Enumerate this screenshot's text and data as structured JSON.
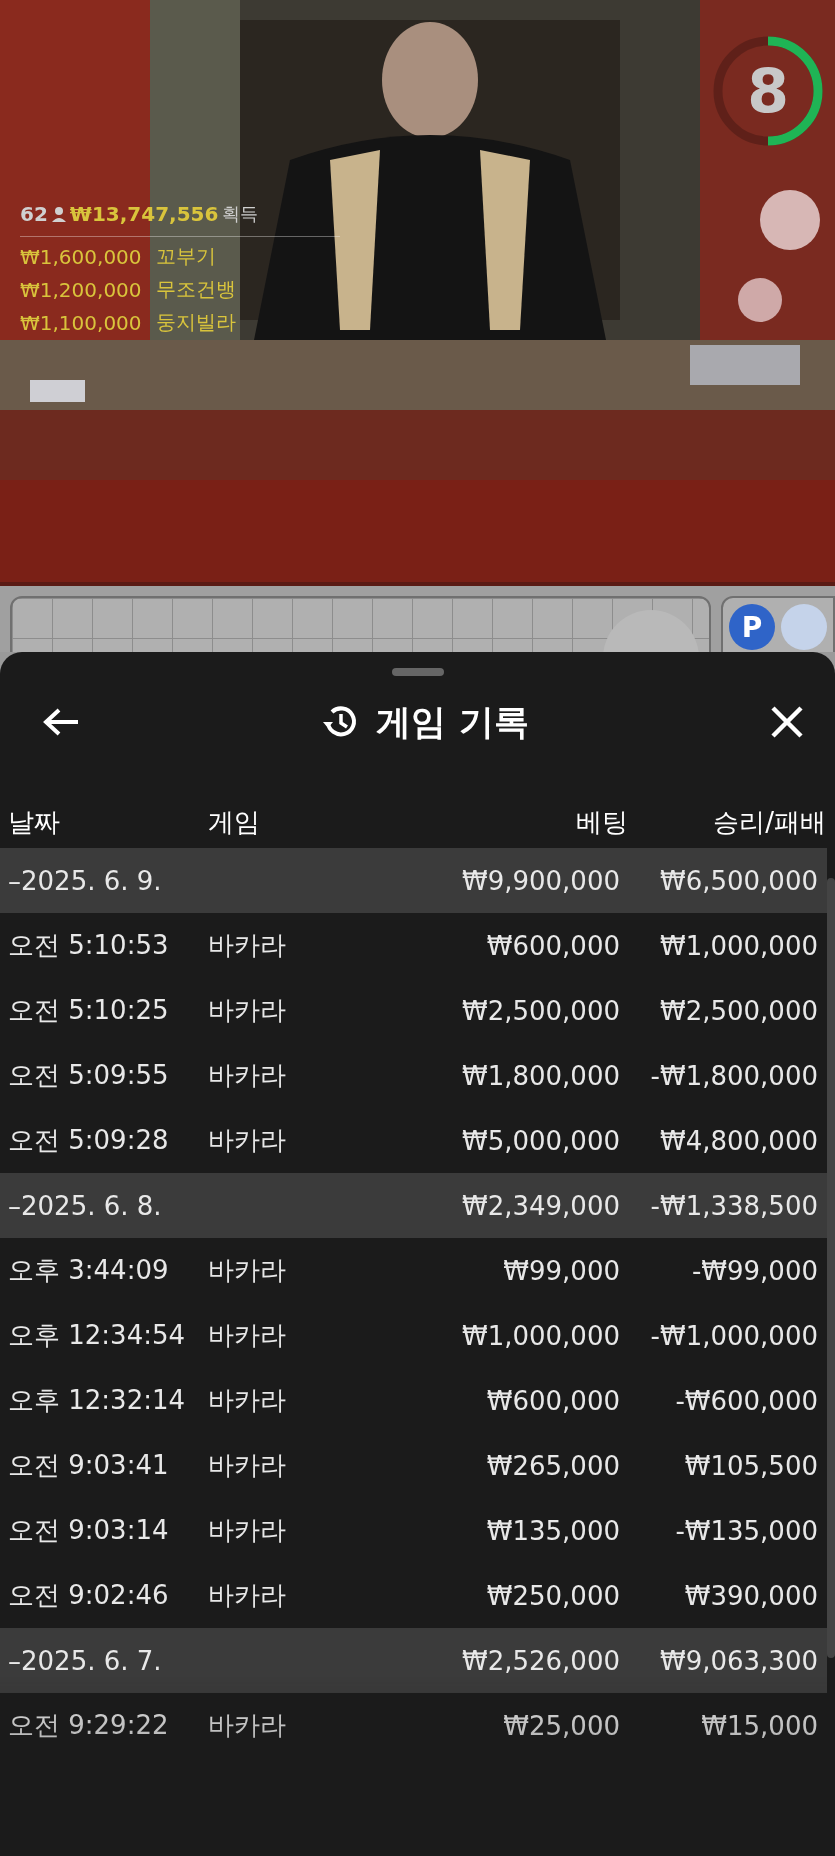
{
  "video": {
    "countdown": {
      "value": "8",
      "level": 0.5
    },
    "stats": {
      "players": "62",
      "total": "₩13,747,556",
      "total_label": "획득"
    },
    "winners": [
      {
        "amount": "₩1,600,000",
        "name": "꼬부기"
      },
      {
        "amount": "₩1,200,000",
        "name": "무조건뱅"
      },
      {
        "amount": "₩1,100,000",
        "name": "둥지빌라"
      }
    ]
  },
  "roadmap": {
    "badge": "P"
  },
  "sheet": {
    "title": "게임 기록",
    "columns": [
      "날짜",
      "게임",
      "베팅",
      "승리/패배"
    ],
    "groups": [
      {
        "date": "–2025. 6. 9.",
        "bet": "₩9,900,000",
        "result": "₩6,500,000",
        "rows": [
          {
            "time": "오전 5:10:53",
            "game": "바카라",
            "bet": "₩600,000",
            "result": "₩1,000,000"
          },
          {
            "time": "오전 5:10:25",
            "game": "바카라",
            "bet": "₩2,500,000",
            "result": "₩2,500,000"
          },
          {
            "time": "오전 5:09:55",
            "game": "바카라",
            "bet": "₩1,800,000",
            "result": "-₩1,800,000"
          },
          {
            "time": "오전 5:09:28",
            "game": "바카라",
            "bet": "₩5,000,000",
            "result": "₩4,800,000"
          }
        ]
      },
      {
        "date": "–2025. 6. 8.",
        "bet": "₩2,349,000",
        "result": "-₩1,338,500",
        "rows": [
          {
            "time": "오후 3:44:09",
            "game": "바카라",
            "bet": "₩99,000",
            "result": "-₩99,000"
          },
          {
            "time": "오후 12:34:54",
            "game": "바카라",
            "bet": "₩1,000,000",
            "result": "-₩1,000,000"
          },
          {
            "time": "오후 12:32:14",
            "game": "바카라",
            "bet": "₩600,000",
            "result": "-₩600,000"
          },
          {
            "time": "오전 9:03:41",
            "game": "바카라",
            "bet": "₩265,000",
            "result": "₩105,500"
          },
          {
            "time": "오전 9:03:14",
            "game": "바카라",
            "bet": "₩135,000",
            "result": "-₩135,000"
          },
          {
            "time": "오전 9:02:46",
            "game": "바카라",
            "bet": "₩250,000",
            "result": "₩390,000"
          }
        ]
      },
      {
        "date": "–2025. 6. 7.",
        "bet": "₩2,526,000",
        "result": "₩9,063,300",
        "rows": [
          {
            "time": "오전 9:29:22",
            "game": "바카라",
            "bet": "₩25,000",
            "result": "₩15,000"
          }
        ]
      }
    ]
  }
}
